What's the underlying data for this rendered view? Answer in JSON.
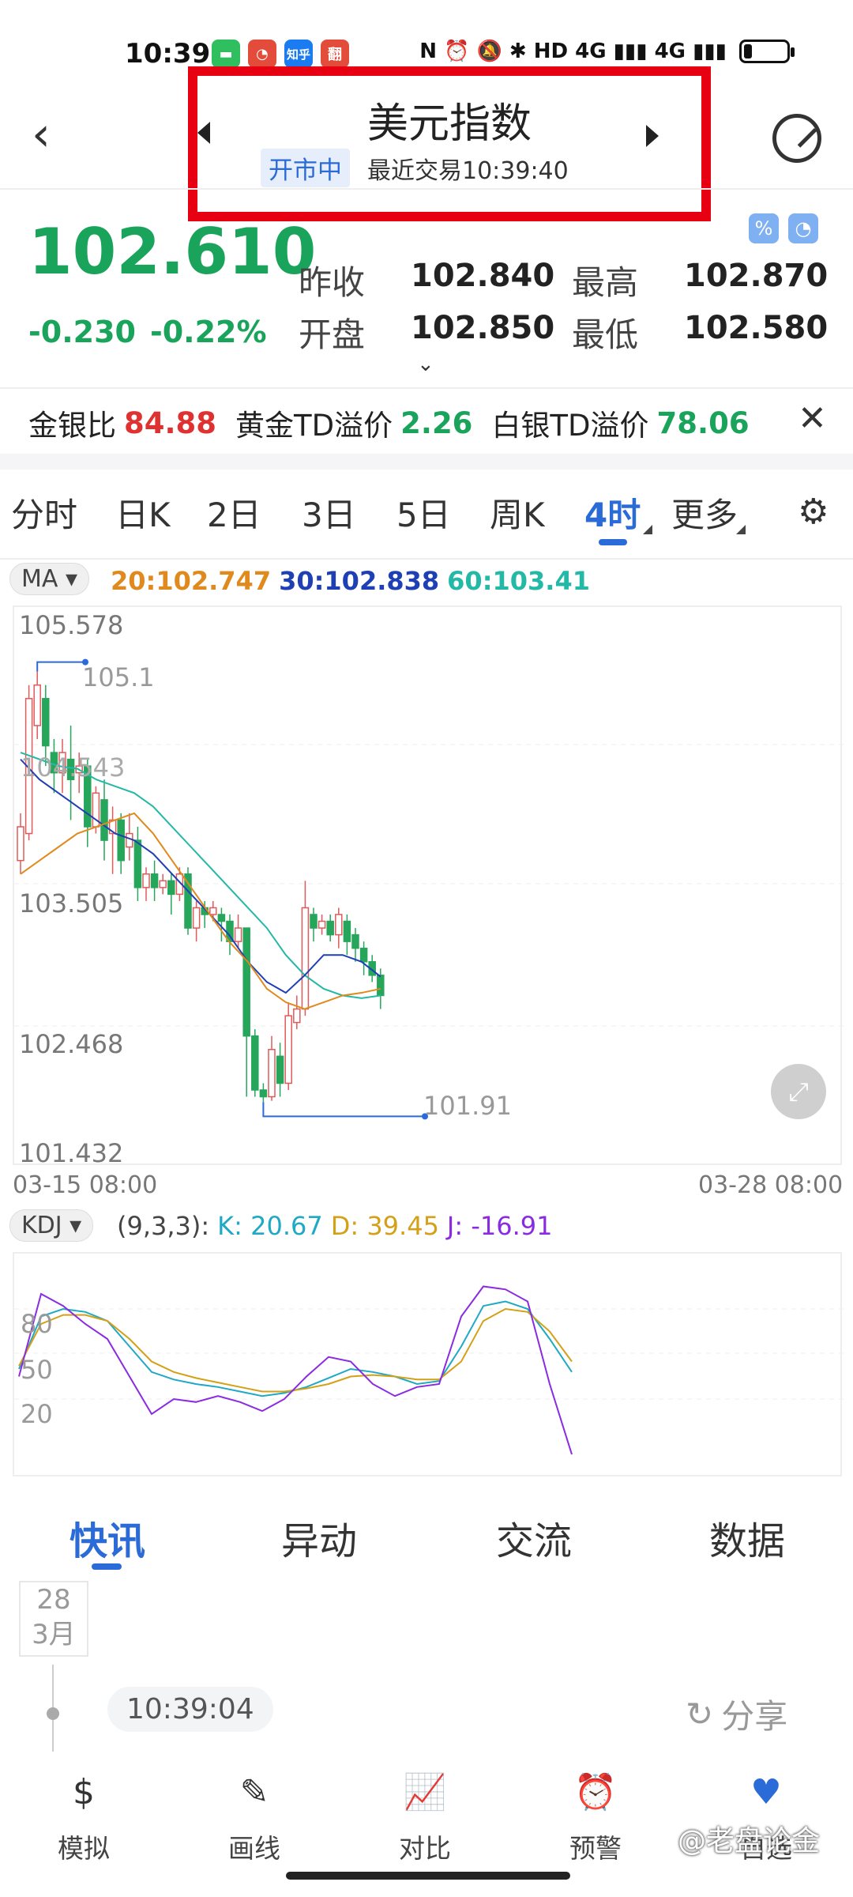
{
  "status": {
    "time": "10:39",
    "app_icons": [
      {
        "name": "message-icon",
        "color": "#2fbf5f",
        "glyph": "▬"
      },
      {
        "name": "weibo-icon",
        "color": "#e34c3b",
        "glyph": "◔"
      },
      {
        "name": "zhihu-icon",
        "color": "#1a7cf0",
        "glyph": "知乎"
      },
      {
        "name": "translate-icon",
        "color": "#e34c3b",
        "glyph": "翻"
      }
    ],
    "right_text": "N ⏰ 🔕 ✱ HD 4G ▮▮▮ 4G ▮▮▮"
  },
  "nav": {
    "title": "美元指数",
    "market_status": "开市中",
    "last_trade": "最近交易10:39:40"
  },
  "quote": {
    "price": "102.610",
    "change": "-0.230",
    "change_pct": "-0.22%",
    "prev_close_label": "昨收",
    "prev_close": "102.840",
    "open_label": "开盘",
    "open": "102.850",
    "high_label": "最高",
    "high": "102.870",
    "low_label": "最低",
    "low": "102.580"
  },
  "ratio_strip": {
    "gold_silver_label": "金银比",
    "gold_silver": "84.88",
    "gold_td_label": "黄金TD溢价",
    "gold_td": "2.26",
    "silver_td_label": "白银TD溢价",
    "silver_td": "78.06"
  },
  "period_tabs": [
    "分时",
    "日K",
    "2日",
    "3日",
    "5日",
    "周K",
    "4时",
    "更多"
  ],
  "active_tab": "4时",
  "ma": {
    "selector": "MA ▾",
    "ma20": "20:102.747",
    "ma30": "30:102.838",
    "ma60": "60:103.41",
    "colors": {
      "ma20": "#e08a1e",
      "ma30": "#1f3fb5",
      "ma60": "#24b8a6"
    }
  },
  "kline": {
    "y_labels": [
      "105.578",
      "103.505",
      "102.468",
      "101.432"
    ],
    "high_marker": "105.1",
    "low_marker": "101.91",
    "overlay_label": "104.543",
    "x_start": "03-15 08:00",
    "x_end": "03-28 08:00"
  },
  "kdj": {
    "selector": "KDJ ▾",
    "params": "(9,3,3):",
    "k": "K: 20.67",
    "d": "D: 39.45",
    "j": "J: -16.91",
    "levels": [
      "80",
      "50",
      "20"
    ],
    "colors": {
      "k": "#1fa9c4",
      "d": "#d4a017",
      "j": "#8a2be2"
    }
  },
  "news_tabs": [
    "快讯",
    "异动",
    "交流",
    "数据"
  ],
  "news": {
    "date_day": "28",
    "date_month": "3月",
    "time": "10:39:04",
    "share": "分享"
  },
  "bottom_nav": [
    {
      "label": "模拟",
      "icon": "simulate-icon"
    },
    {
      "label": "画线",
      "icon": "draw-line-icon"
    },
    {
      "label": "对比",
      "icon": "compare-icon"
    },
    {
      "label": "预警",
      "icon": "alert-icon"
    },
    {
      "label": "自选",
      "icon": "favorite-icon"
    }
  ],
  "watermark": "@老盘论金",
  "chart_data": {
    "type": "candlestick",
    "title": "美元指数 4时",
    "x_range": [
      "03-15 08:00",
      "03-28 08:00"
    ],
    "y_range": [
      101.432,
      105.578
    ],
    "ma": {
      "MA20": 102.747,
      "MA30": 102.838,
      "MA60": 103.41
    },
    "extremes": {
      "high": 105.1,
      "low": 101.91
    }
  }
}
